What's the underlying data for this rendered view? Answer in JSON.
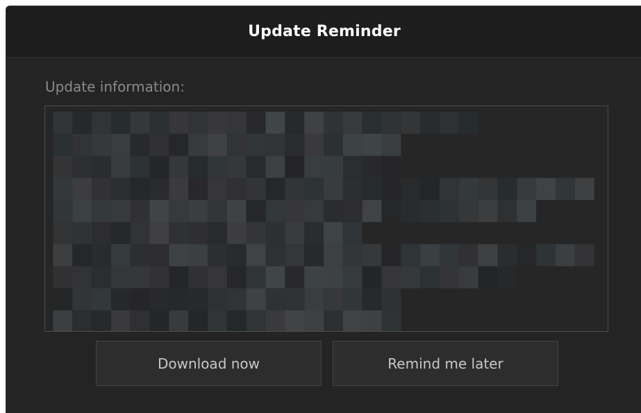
{
  "dialog": {
    "title": "Update Reminder",
    "info_label": "Update information:",
    "info_content_redacted": true,
    "buttons": {
      "download": "Download now",
      "remind": "Remind me later"
    }
  },
  "colors": {
    "background": "#242424",
    "titlebar": "#1d1d1d",
    "title_text": "#ffffff",
    "label_text": "#8a8a8a",
    "button_bg": "#2d2d2d",
    "button_border": "#454545",
    "button_text": "#c8c8c8"
  }
}
